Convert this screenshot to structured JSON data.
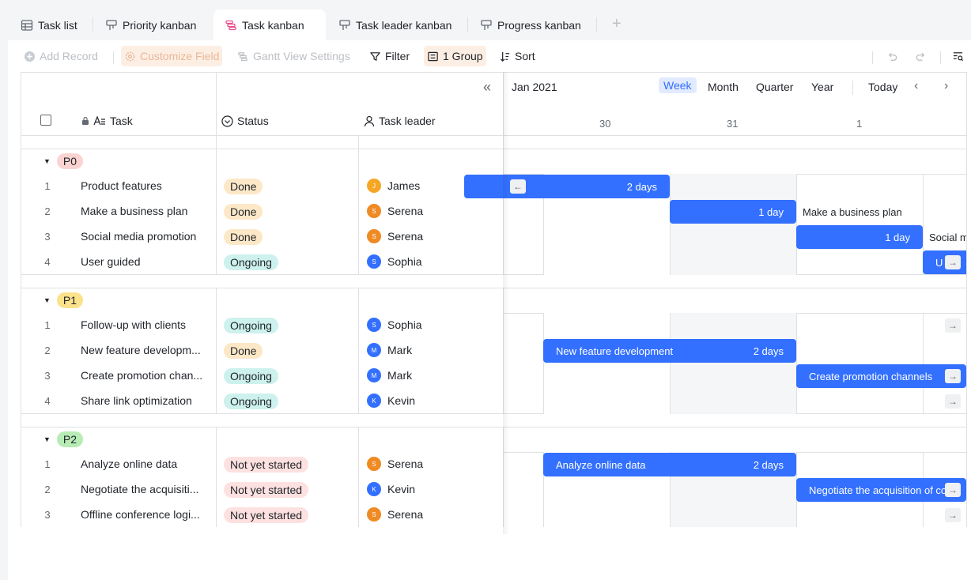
{
  "tabs": [
    {
      "label": "Task list",
      "icon": "table-icon"
    },
    {
      "label": "Priority kanban",
      "icon": "kanban-icon"
    },
    {
      "label": "Task kanban",
      "icon": "gantt-icon",
      "active": true
    },
    {
      "label": "Task leader kanban",
      "icon": "kanban-icon"
    },
    {
      "label": "Progress kanban",
      "icon": "kanban-icon"
    }
  ],
  "toolbar": {
    "add_record": "Add Record",
    "customize_field": "Customize Field",
    "gantt_settings": "Gantt View Settings",
    "filter": "Filter",
    "group": "1 Group",
    "sort": "Sort"
  },
  "columns": {
    "task": "Task",
    "status": "Status",
    "leader": "Task leader"
  },
  "timeline": {
    "month": "Jan 2021",
    "scales": [
      "Week",
      "Month",
      "Quarter",
      "Year"
    ],
    "active_scale": "Week",
    "today": "Today",
    "days": [
      "30",
      "31",
      "1"
    ]
  },
  "groups": [
    {
      "label": "P0",
      "color": "#fbd3d0",
      "rows": [
        {
          "num": "1",
          "task": "Product features",
          "status": "Done",
          "leader": "James",
          "initial": "J",
          "avatar": "#f5a623",
          "bar": {
            "label": "",
            "days": "2 days",
            "outside": ""
          }
        },
        {
          "num": "2",
          "task": "Make a business plan",
          "status": "Done",
          "leader": "Serena",
          "initial": "S",
          "avatar": "#f08a24",
          "bar": {
            "label": "",
            "days": "1 day",
            "outside": "Make a business plan"
          }
        },
        {
          "num": "3",
          "task": "Social media promotion",
          "status": "Done",
          "leader": "Serena",
          "initial": "S",
          "avatar": "#f08a24",
          "bar": {
            "label": "",
            "days": "1 day",
            "outside": "Social m"
          }
        },
        {
          "num": "4",
          "task": "User guided",
          "status": "Ongoing",
          "leader": "Sophia",
          "initial": "S",
          "avatar": "#3370ff",
          "bar": {
            "label": "U",
            "days": "",
            "outside": ""
          }
        }
      ]
    },
    {
      "label": "P1",
      "color": "#fbe28b",
      "rows": [
        {
          "num": "1",
          "task": "Follow-up with clients",
          "status": "Ongoing",
          "leader": "Sophia",
          "initial": "S",
          "avatar": "#3370ff",
          "bar": {
            "label": "",
            "days": "",
            "outside": ""
          }
        },
        {
          "num": "2",
          "task": "New feature developm...",
          "status": "Done",
          "leader": "Mark",
          "initial": "M",
          "avatar": "#3370ff",
          "bar": {
            "label": "New feature development",
            "days": "2 days",
            "outside": ""
          }
        },
        {
          "num": "3",
          "task": "Create promotion chan...",
          "status": "Ongoing",
          "leader": "Mark",
          "initial": "M",
          "avatar": "#3370ff",
          "bar": {
            "label": "Create promotion channels",
            "days": "",
            "outside": ""
          }
        },
        {
          "num": "4",
          "task": "Share link optimization",
          "status": "Ongoing",
          "leader": "Kevin",
          "initial": "K",
          "avatar": "#3370ff",
          "bar": {
            "label": "",
            "days": "",
            "outside": ""
          }
        }
      ]
    },
    {
      "label": "P2",
      "color": "#b7ecb5",
      "rows": [
        {
          "num": "1",
          "task": "Analyze online data",
          "status": "Not yet started",
          "leader": "Serena",
          "initial": "S",
          "avatar": "#f08a24",
          "bar": {
            "label": "Analyze online data",
            "days": "2 days",
            "outside": ""
          }
        },
        {
          "num": "2",
          "task": "Negotiate the acquisiti...",
          "status": "Not yet started",
          "leader": "Kevin",
          "initial": "K",
          "avatar": "#3370ff",
          "bar": {
            "label": "Negotiate the acquisition of co",
            "days": "",
            "outside": ""
          }
        },
        {
          "num": "3",
          "task": "Offline conference logi...",
          "status": "Not yet started",
          "leader": "Serena",
          "initial": "S",
          "avatar": "#f08a24",
          "bar": {
            "label": "",
            "days": "",
            "outside": ""
          }
        }
      ]
    }
  ],
  "status_colors": {
    "Done": "#fce8c7",
    "Ongoing": "#cdf1ec",
    "Not yet started": "#fde1e0"
  }
}
